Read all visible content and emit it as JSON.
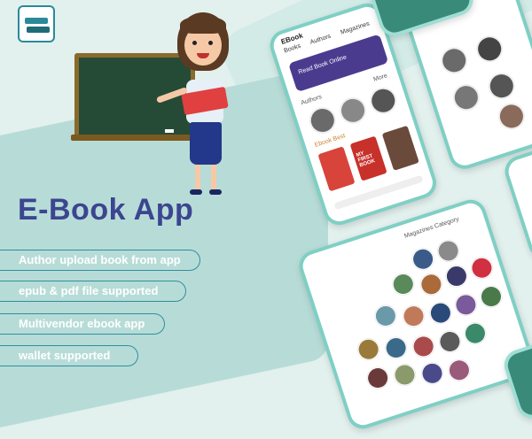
{
  "app_title": "E-Book App",
  "features": [
    "Author upload book from app",
    "epub & pdf file supported",
    "Multivendor ebook app",
    "wallet supported"
  ],
  "colors": {
    "background": "#e2f0ee",
    "accent_shape": "#b7dcd7",
    "title": "#3c4590",
    "pill_border": "#2f8f9f",
    "phone_border": "#7fcfc4",
    "banner": "#4b3b8f"
  },
  "phone_main": {
    "header": "EBook",
    "tabs": [
      "Books",
      "Authors",
      "Magazines"
    ],
    "banner_text": "Read Book Online",
    "more_label": "More",
    "authors_section": "Authors",
    "books_section": "Ebook Best",
    "book_cover_text": "MY FIRST BOOK"
  },
  "phone_bottom": {
    "header": "Magazines Category"
  }
}
